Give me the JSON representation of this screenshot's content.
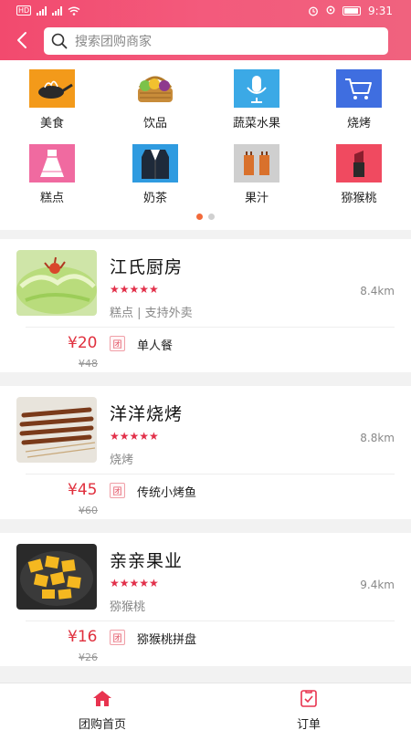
{
  "status_bar": {
    "time": "9:31",
    "network_badge": "HD"
  },
  "search": {
    "placeholder": "搜索团购商家"
  },
  "categories": [
    {
      "label": "美食",
      "icon": "wok-cooking-icon",
      "color": "#f39a1a"
    },
    {
      "label": "饮品",
      "icon": "fruit-basket-icon",
      "color": "#ffffff"
    },
    {
      "label": "蔬菜水果",
      "icon": "microphone-icon",
      "color": "#3ba9e6"
    },
    {
      "label": "烧烤",
      "icon": "shopping-cart-icon",
      "color": "#3f6ee0"
    },
    {
      "label": "糕点",
      "icon": "dress-icon",
      "color": "#f06aa0"
    },
    {
      "label": "奶茶",
      "icon": "suit-icon",
      "color": "#2f9be0"
    },
    {
      "label": "果汁",
      "icon": "vest-icon",
      "color": "#cccccc"
    },
    {
      "label": "猕猴桃",
      "icon": "lipstick-icon",
      "color": "#f04a60"
    }
  ],
  "pager": {
    "pages": 2,
    "active": 0
  },
  "shops": [
    {
      "name": "江氏厨房",
      "rating": 5,
      "stars": "★★★★★",
      "distance": "8.4km",
      "desc": "糕点 | 支持外卖",
      "price": "¥20",
      "original_price": "¥48",
      "tag": "团",
      "deal": "单人餐"
    },
    {
      "name": "洋洋烧烤",
      "rating": 5,
      "stars": "★★★★★",
      "distance": "8.8km",
      "desc": "烧烤",
      "price": "¥45",
      "original_price": "¥60",
      "tag": "团",
      "deal": "传统小烤鱼"
    },
    {
      "name": "亲亲果业",
      "rating": 5,
      "stars": "★★★★★",
      "distance": "9.4km",
      "desc": "猕猴桃",
      "price": "¥16",
      "original_price": "¥26",
      "tag": "团",
      "deal": "猕猴桃拼盘"
    }
  ],
  "bottom_nav": [
    {
      "label": "团购首页",
      "icon": "home-icon",
      "active": true
    },
    {
      "label": "订单",
      "icon": "order-clipboard-icon",
      "active": false
    }
  ],
  "colors": {
    "accent": "#f24a6e",
    "price": "#e0303e"
  }
}
